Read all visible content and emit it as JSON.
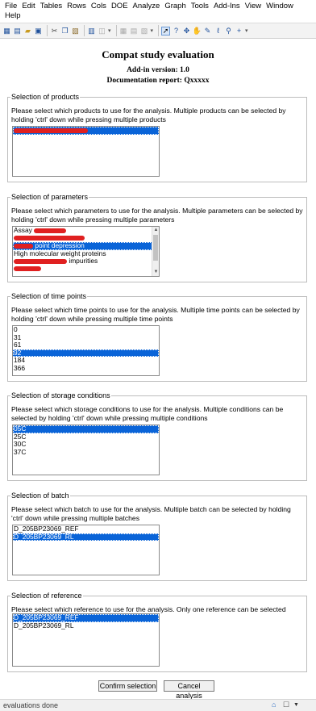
{
  "menu": [
    "File",
    "Edit",
    "Tables",
    "Rows",
    "Cols",
    "DOE",
    "Analyze",
    "Graph",
    "Tools",
    "Add-Ins",
    "View",
    "Window",
    "Help"
  ],
  "toolbar": {
    "icons": [
      "new-data-table-icon",
      "new-script-icon",
      "open-folder-icon",
      "save-icon",
      "cut-icon",
      "copy-icon",
      "paste-icon",
      "journal-icon",
      "lock-icon",
      "graph-builder-icon",
      "tabulate-icon",
      "distribution-icon",
      "arrow-select-icon",
      "help-pointer-icon",
      "crosshair-icon",
      "hand-icon",
      "brush-icon",
      "lasso-icon",
      "magnifier-icon",
      "plus-icon"
    ]
  },
  "header": {
    "title": "Compat study evaluation",
    "version": "Add-in version: 1.0",
    "report": "Documentation report: Qxxxxx"
  },
  "products": {
    "legend": "Selection of products",
    "desc": "Please select which products to use for the analysis. Multiple products can be selected by holding 'ctrl' down while pressing multiple products",
    "items": [
      {
        "label": "",
        "selected": true
      }
    ]
  },
  "parameters": {
    "legend": "Selection of parameters",
    "desc": "Please select which parameters to use for the analysis. Multiple parameters can be selected by holding 'ctrl' down while pressing multiple parameters",
    "items": [
      {
        "label": "Assay ",
        "selected": false
      },
      {
        "label": "",
        "selected": false
      },
      {
        "label": " point depression",
        "selected": true
      },
      {
        "label": "High molecular weight proteins",
        "selected": false
      },
      {
        "label": " impurities",
        "selected": false
      },
      {
        "label": "",
        "selected": false
      }
    ]
  },
  "timepoints": {
    "legend": "Selection of time points",
    "desc": "Please select which time points to use for the analysis. Multiple time points can be selected by holding 'ctrl' down while pressing multiple time points",
    "items": [
      {
        "label": "0",
        "selected": false
      },
      {
        "label": "31",
        "selected": false
      },
      {
        "label": "61",
        "selected": false
      },
      {
        "label": "92",
        "selected": true
      },
      {
        "label": "184",
        "selected": false
      },
      {
        "label": "366",
        "selected": false
      }
    ]
  },
  "storage": {
    "legend": "Selection of storage conditions",
    "desc": "Please select which storage conditions to use for the analysis. Multiple conditions can be selected by holding 'ctrl' down while pressing multiple conditions",
    "items": [
      {
        "label": "05C",
        "selected": true
      },
      {
        "label": "25C",
        "selected": false
      },
      {
        "label": "30C",
        "selected": false
      },
      {
        "label": "37C",
        "selected": false
      }
    ]
  },
  "batch": {
    "legend": "Selection of batch",
    "desc": "Please select which batch to use for the analysis. Multiple batch can be selected by holding 'ctrl' down while pressing multiple batches",
    "items": [
      {
        "label": "D_205BP23069_REF",
        "selected": false
      },
      {
        "label": "D_205BP23069_RL",
        "selected": true
      }
    ]
  },
  "reference": {
    "legend": "Selection of reference",
    "desc": "Please select which reference to use for the analysis. Only one reference can be selected",
    "items": [
      {
        "label": "D_205BP23069_REF",
        "selected": true
      },
      {
        "label": "D_205BP23069_RL",
        "selected": false
      }
    ]
  },
  "buttons": {
    "confirm": "Confirm selection",
    "cancel": "Cancel analysis"
  },
  "status": {
    "text": "evaluations done"
  },
  "colors": {
    "selection": "#0a64d8",
    "redaction": "#e02020"
  }
}
